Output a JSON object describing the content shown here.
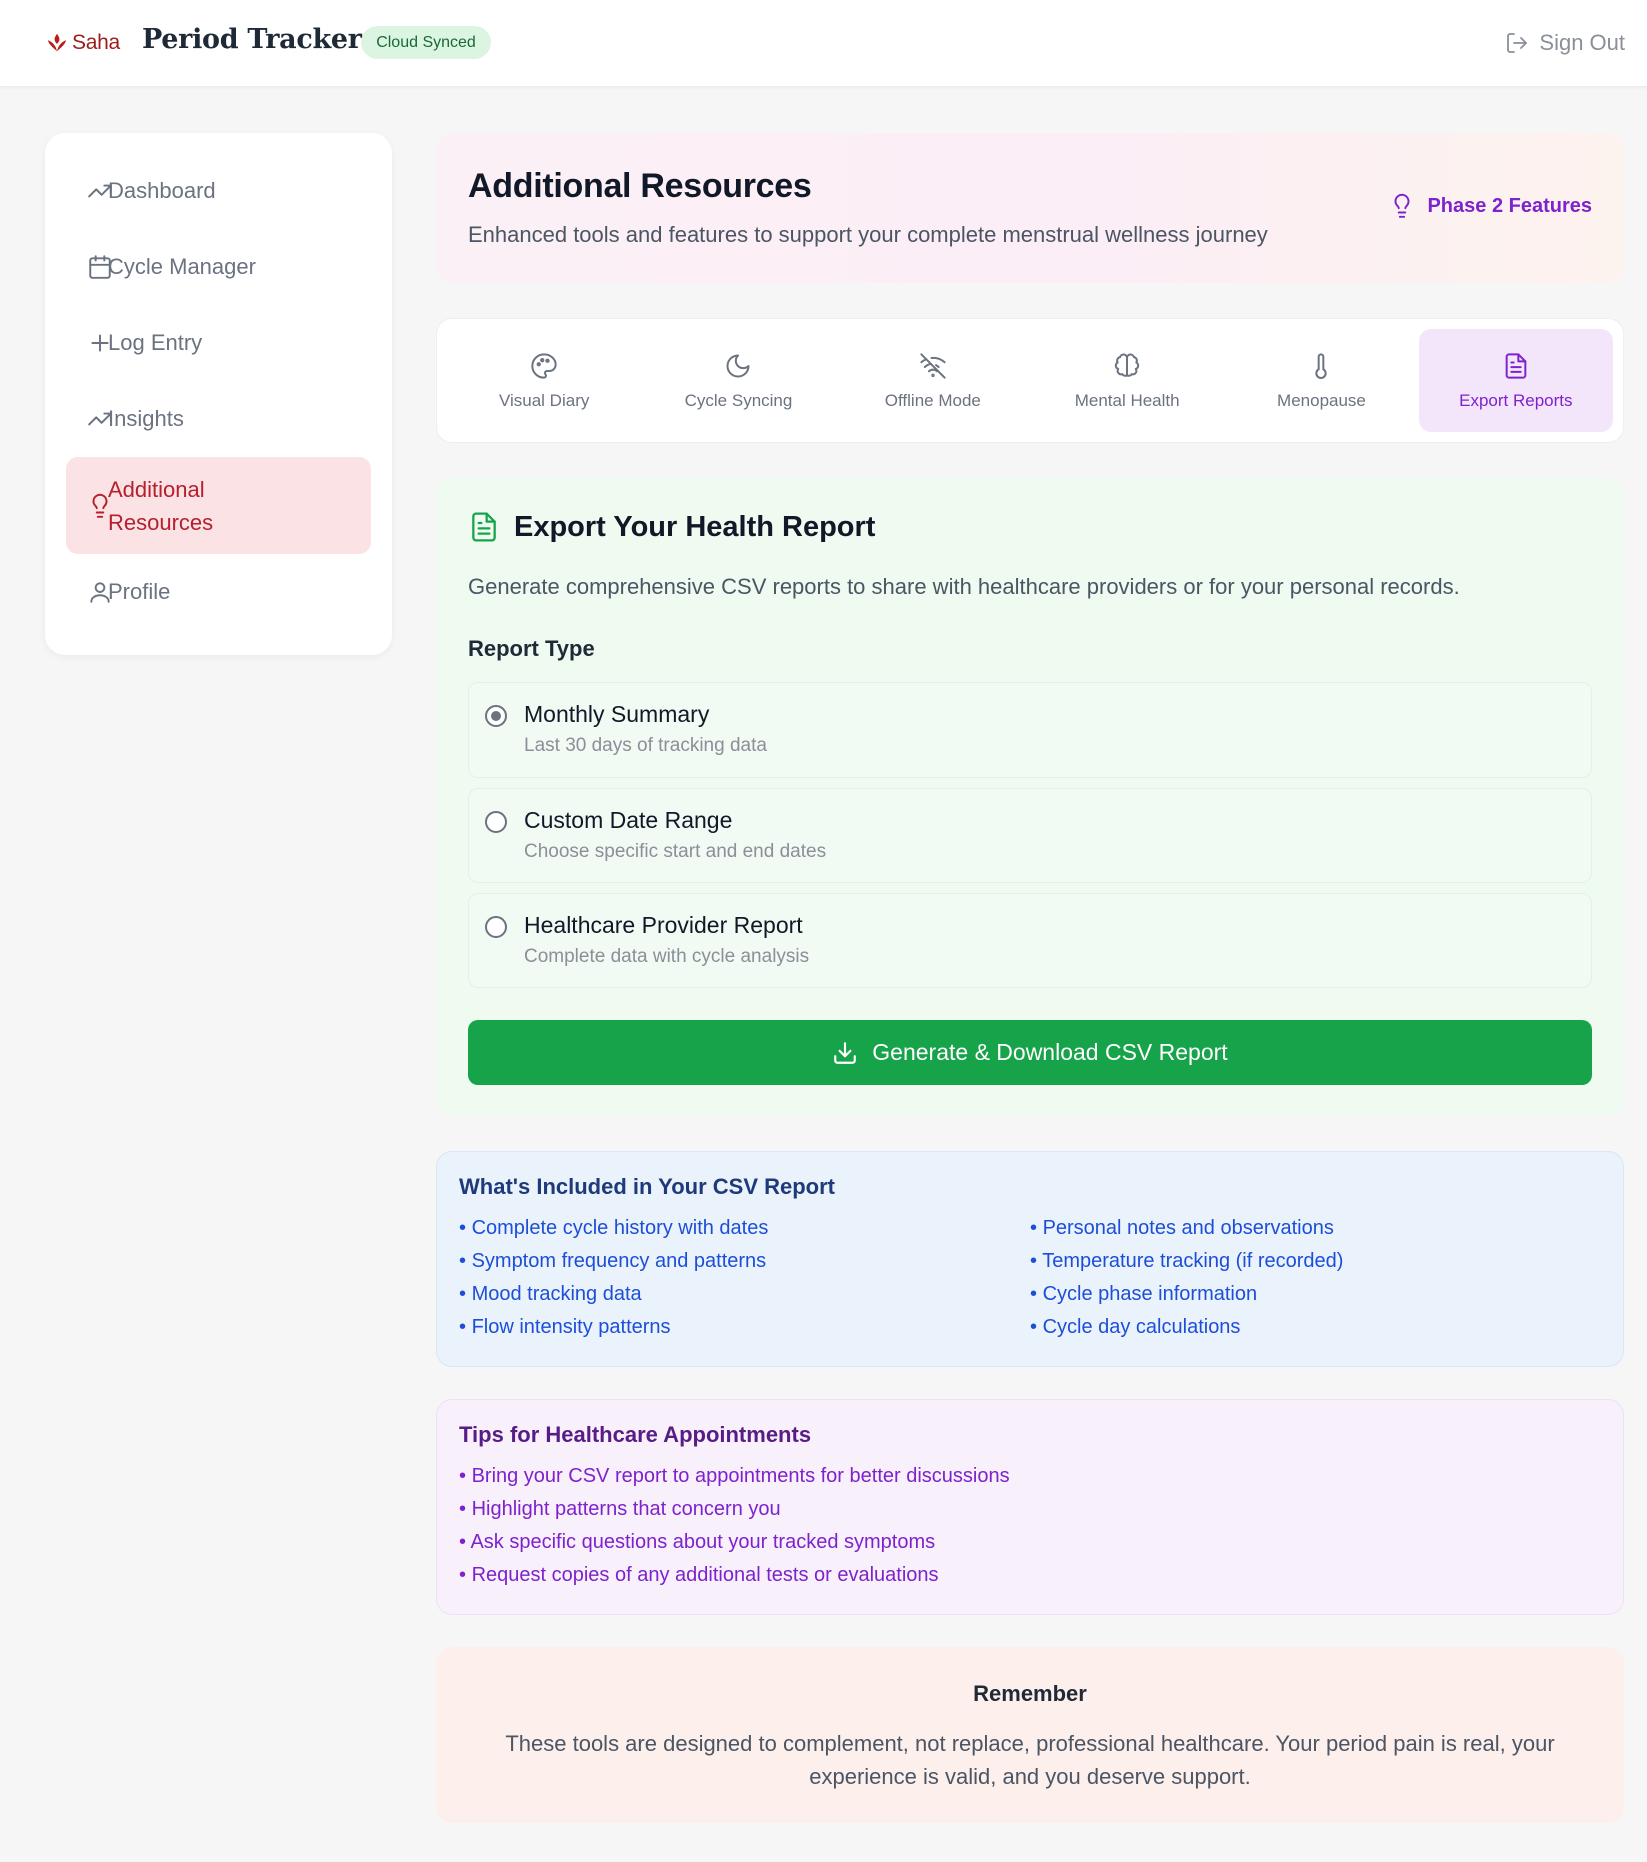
{
  "header": {
    "logo_text": "Saha",
    "app_title": "Period Tracker",
    "sync_badge": "Cloud Synced",
    "sign_out": "Sign Out"
  },
  "sidebar": {
    "items": [
      {
        "label": "Dashboard",
        "icon": "trending-up-icon"
      },
      {
        "label": "Cycle Manager",
        "icon": "calendar-icon"
      },
      {
        "label": "Log Entry",
        "icon": "plus-icon"
      },
      {
        "label": "Insights",
        "icon": "trending-up-icon"
      },
      {
        "label": "Additional Resources",
        "icon": "lightbulb-icon",
        "active": true
      },
      {
        "label": "Profile",
        "icon": "user-icon"
      }
    ]
  },
  "hero": {
    "title": "Additional Resources",
    "subtitle": "Enhanced tools and features to support your complete menstrual wellness journey",
    "badge": "Phase 2 Features"
  },
  "tabs": [
    {
      "label": "Visual Diary",
      "icon": "palette-icon"
    },
    {
      "label": "Cycle Syncing",
      "icon": "moon-icon"
    },
    {
      "label": "Offline Mode",
      "icon": "wifi-off-icon"
    },
    {
      "label": "Mental Health",
      "icon": "brain-icon"
    },
    {
      "label": "Menopause",
      "icon": "thermometer-icon"
    },
    {
      "label": "Export Reports",
      "icon": "file-text-icon",
      "active": true
    }
  ],
  "export": {
    "title": "Export Your Health Report",
    "description": "Generate comprehensive CSV reports to share with healthcare providers or for your personal records.",
    "report_type_label": "Report Type",
    "options": [
      {
        "title": "Monthly Summary",
        "subtitle": "Last 30 days of tracking data",
        "checked": true
      },
      {
        "title": "Custom Date Range",
        "subtitle": "Choose specific start and end dates",
        "checked": false
      },
      {
        "title": "Healthcare Provider Report",
        "subtitle": "Complete data with cycle analysis",
        "checked": false
      }
    ],
    "button": "Generate & Download CSV Report"
  },
  "included": {
    "title": "What's Included in Your CSV Report",
    "left": [
      "Complete cycle history with dates",
      "Symptom frequency and patterns",
      "Mood tracking data",
      "Flow intensity patterns"
    ],
    "right": [
      "Personal notes and observations",
      "Temperature tracking (if recorded)",
      "Cycle phase information",
      "Cycle day calculations"
    ]
  },
  "tips": {
    "title": "Tips for Healthcare Appointments",
    "items": [
      "Bring your CSV report to appointments for better discussions",
      "Highlight patterns that concern you",
      "Ask specific questions about your tracked symptoms",
      "Request copies of any additional tests or evaluations"
    ]
  },
  "remember": {
    "title": "Remember",
    "text": "These tools are designed to complement, not replace, professional healthcare. Your period pain is real, your experience is valid, and you deserve support."
  },
  "colors": {
    "brand": "#9b1c1c",
    "accent_purple": "#7e22ce",
    "success_green": "#16a34a",
    "active_nav_bg": "#fbe2e4"
  }
}
